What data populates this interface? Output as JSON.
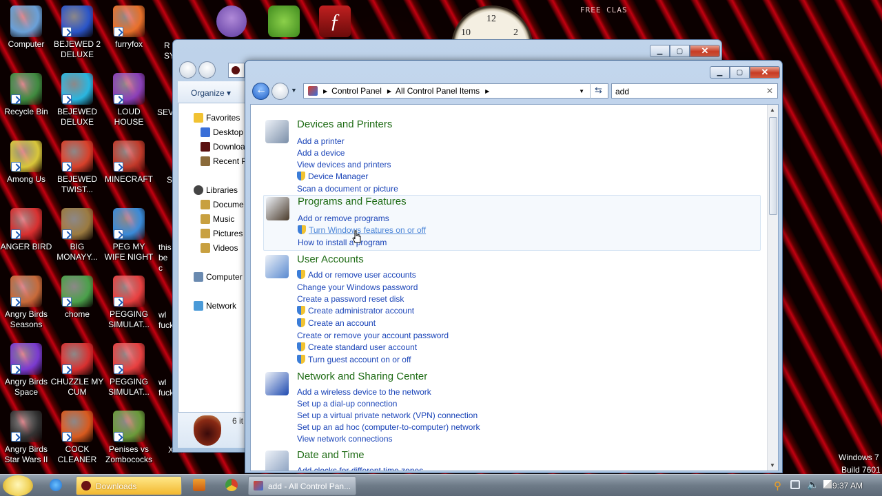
{
  "desktop": {
    "icons": [
      {
        "label": "Computer",
        "color": "#6aa0d8"
      },
      {
        "label": "BEJEWED 2 DELUXE",
        "color": "#2a55c8"
      },
      {
        "label": "furryfox",
        "color": "#e8702a"
      },
      {
        "label": "Recycle Bin",
        "color": "#3f8a3f"
      },
      {
        "label": "BEJEWED DELUXE",
        "color": "#29b6e0"
      },
      {
        "label": "LOUD HOUSE",
        "color": "#8a3fb8"
      },
      {
        "label": "Among Us",
        "color": "#d8c63a"
      },
      {
        "label": "BEJEWED TWIST...",
        "color": "#d8402a"
      },
      {
        "label": "MINECRAFT",
        "color": "#c23a2a"
      },
      {
        "label": "ANGER BIRD",
        "color": "#d83030"
      },
      {
        "label": "BIG MONAYY...",
        "color": "#9a7a40"
      },
      {
        "label": "PEG MY WIFE NIGHT",
        "color": "#3a8ad8"
      },
      {
        "label": "Angry Birds Seasons",
        "color": "#c86a3a"
      },
      {
        "label": "chome",
        "color": "#4aa04a"
      },
      {
        "label": "PEGGING SIMULAT...",
        "color": "#e84040"
      },
      {
        "label": "Angry Birds Space",
        "color": "#7a3ad0"
      },
      {
        "label": "CHUZZLE MY CUM",
        "color": "#d83030"
      },
      {
        "label": "PEGGING SIMULAT...",
        "color": "#e84040"
      },
      {
        "label": "Angry Birds Star Wars II",
        "color": "#333333"
      },
      {
        "label": "COCK CLEANER",
        "color": "#d85a1e"
      },
      {
        "label": "Penises vs Zombococks",
        "color": "#6a9a3a"
      }
    ],
    "partial_labels": [
      "R SY",
      "SEVE",
      "S",
      "this be c",
      "wl fuck",
      "wl fuck",
      "XMP"
    ],
    "clock": {
      "n12": "12",
      "n10": "10",
      "n2": "2"
    },
    "wallpaper_tag": "FREE CLAS"
  },
  "back_window": {
    "organize": "Organize ▾",
    "nav": [
      {
        "label": "Favorites"
      },
      {
        "label": "Desktop"
      },
      {
        "label": "Downloa"
      },
      {
        "label": "Recent P"
      },
      {
        "label": "Libraries"
      },
      {
        "label": "Docume"
      },
      {
        "label": "Music"
      },
      {
        "label": "Pictures"
      },
      {
        "label": "Videos"
      },
      {
        "label": "Computer"
      },
      {
        "label": "Network"
      }
    ],
    "status": "6 it"
  },
  "front_window": {
    "breadcrumb": [
      "Control Panel",
      "All Control Panel Items"
    ],
    "search_value": "add",
    "search_clear": "✕",
    "groups": [
      {
        "title": "Devices and Printers",
        "links": [
          {
            "text": "Add a printer",
            "shield": false
          },
          {
            "text": "Add a device",
            "shield": false
          },
          {
            "text": "View devices and printers",
            "shield": false
          },
          {
            "text": "Device Manager",
            "shield": true
          },
          {
            "text": "Scan a document or picture",
            "shield": false
          }
        ]
      },
      {
        "title": "Programs and Features",
        "links": [
          {
            "text": "Add or remove programs",
            "shield": false
          },
          {
            "text": "Turn Windows features on or off",
            "shield": true
          },
          {
            "text": "How to install a program",
            "shield": false
          }
        ]
      },
      {
        "title": "User Accounts",
        "links": [
          {
            "text": "Add or remove user accounts",
            "shield": true
          },
          {
            "text": "Change your Windows password",
            "shield": false
          },
          {
            "text": "Create a password reset disk",
            "shield": false
          },
          {
            "text": "Create administrator account",
            "shield": true
          },
          {
            "text": "Create an account",
            "shield": true
          },
          {
            "text": "Create or remove your account password",
            "shield": false
          },
          {
            "text": "Create standard user account",
            "shield": true
          },
          {
            "text": "Turn guest account on or off",
            "shield": true
          }
        ]
      },
      {
        "title": "Network and Sharing Center",
        "links": [
          {
            "text": "Add a wireless device to the network",
            "shield": false
          },
          {
            "text": "Set up a dial-up connection",
            "shield": false
          },
          {
            "text": "Set up a virtual private network (VPN) connection",
            "shield": false
          },
          {
            "text": "Set up an ad hoc (computer-to-computer) network",
            "shield": false
          },
          {
            "text": "View network connections",
            "shield": false
          }
        ]
      },
      {
        "title": "Date and Time",
        "links": [
          {
            "text": "Add clocks for different time zones",
            "shield": false
          }
        ]
      }
    ]
  },
  "taskbar": {
    "downloads_label": "Downloads",
    "control_panel_label": "add - All Control Pan...",
    "clock": "9:37 AM"
  },
  "watermark": {
    "line1": "Windows 7",
    "line2": "Build 7601"
  }
}
